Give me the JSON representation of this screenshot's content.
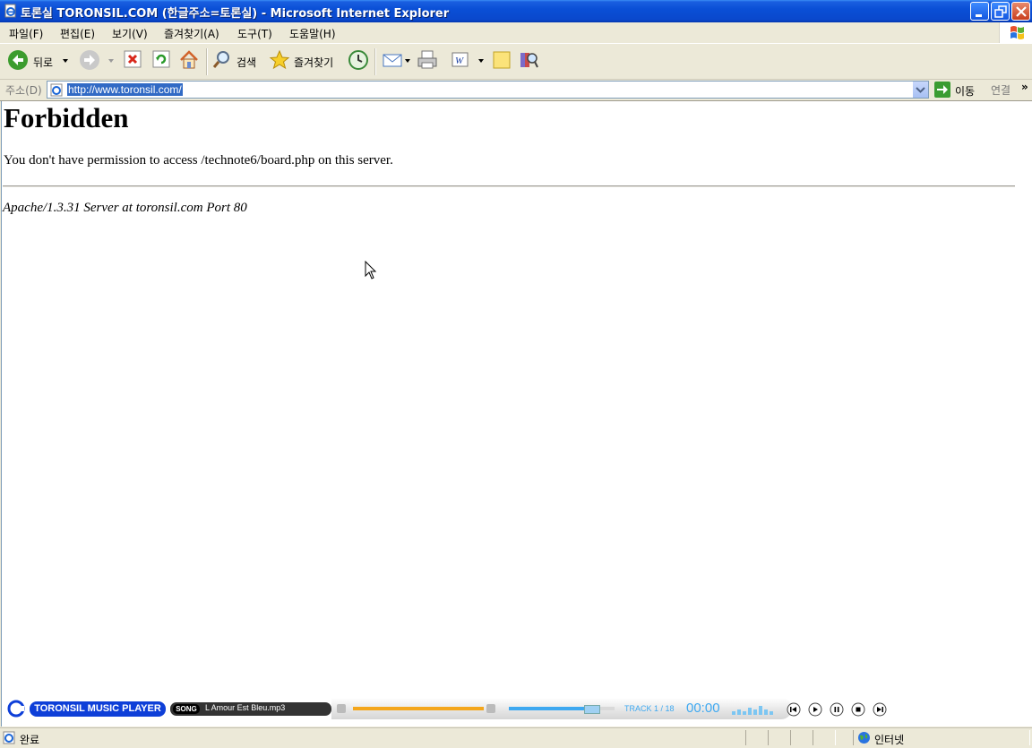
{
  "window": {
    "title": "토론실 TORONSIL.COM (한글주소=토론실) - Microsoft Internet Explorer"
  },
  "menu": {
    "items": [
      "파일(F)",
      "편집(E)",
      "보기(V)",
      "즐겨찾기(A)",
      "도구(T)",
      "도움말(H)"
    ]
  },
  "toolbar": {
    "back_label": "뒤로",
    "search_label": "검색",
    "favorites_label": "즐겨찾기"
  },
  "address": {
    "label": "주소(D)",
    "url": "http://www.toronsil.com/",
    "go_label": "이동",
    "links_label": "연결",
    "links_chevron": "»"
  },
  "page": {
    "heading": "Forbidden",
    "message": "You don't have permission to access /technote6/board.php on this server.",
    "server_signature": "Apache/1.3.31 Server at toronsil.com Port 80"
  },
  "player": {
    "title": "TORONSIL MUSIC PLAYER",
    "song_tag": "SONG",
    "song_name": "L Amour Est Bleu.mp3",
    "track": "TRACK 1 / 18",
    "time": "00:00",
    "progress_fraction": 1.0,
    "volume_fraction": 0.85,
    "accent_color": "#3ea8f0",
    "progress_color": "#f4a61c"
  },
  "status": {
    "text": "완료",
    "zone": "인터넷"
  },
  "colors": {
    "titlebar": "#0a4fd6",
    "chrome": "#ece9d8",
    "selection": "#316ac5"
  }
}
